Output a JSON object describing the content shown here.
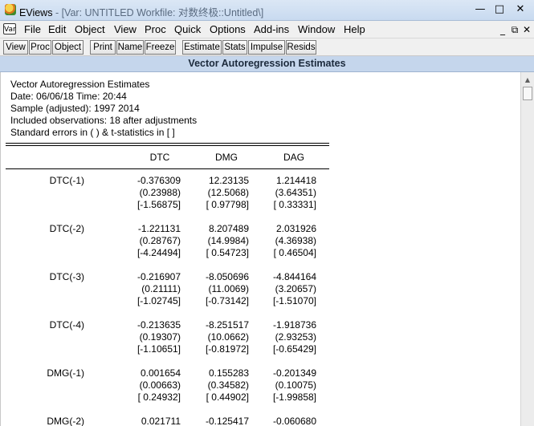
{
  "window": {
    "app_name": "EViews",
    "title_detail": " - [Var: UNTITLED    Workfile: 对数终极::Untitled\\]",
    "minimize": "—",
    "restore": "□",
    "close": "✕",
    "mdi_minimize": "_",
    "mdi_restore": "⧉",
    "mdi_close": "✕"
  },
  "menu": {
    "icon_label": "Var",
    "items": [
      "File",
      "Edit",
      "Object",
      "View",
      "Proc",
      "Quick",
      "Options",
      "Add-ins",
      "Window",
      "Help"
    ]
  },
  "toolbar": {
    "buttons": [
      "View",
      "Proc",
      "Object",
      "Print",
      "Name",
      "Freeze",
      "Estimate",
      "Stats",
      "Impulse",
      "Resids"
    ]
  },
  "header_band": "Vector Autoregression Estimates",
  "output": {
    "title": "Vector Autoregression Estimates",
    "date_line": "Date: 06/06/18   Time: 20:44",
    "sample_line": "Sample (adjusted): 1997 2014",
    "obs_line": "Included observations: 18 after adjustments",
    "se_line": "Standard errors in ( ) & t-statistics in [ ]",
    "columns": [
      "DTC",
      "DMG",
      "DAG"
    ],
    "rows": [
      {
        "label": "DTC(-1)",
        "coef": [
          "-0.376309",
          "12.23135",
          "1.214418"
        ],
        "se": [
          "(0.23988)",
          "(12.5068)",
          "(3.64351)"
        ],
        "t": [
          "[-1.56875]",
          "[ 0.97798]",
          "[ 0.33331]"
        ]
      },
      {
        "label": "DTC(-2)",
        "coef": [
          "-1.221131",
          "8.207489",
          "2.031926"
        ],
        "se": [
          "(0.28767)",
          "(14.9984)",
          "(4.36938)"
        ],
        "t": [
          "[-4.24494]",
          "[ 0.54723]",
          "[ 0.46504]"
        ]
      },
      {
        "label": "DTC(-3)",
        "coef": [
          "-0.216907",
          "-8.050696",
          "-4.844164"
        ],
        "se": [
          "(0.21111)",
          "(11.0069)",
          "(3.20657)"
        ],
        "t": [
          "[-1.02745]",
          "[-0.73142]",
          "[-1.51070]"
        ]
      },
      {
        "label": "DTC(-4)",
        "coef": [
          "-0.213635",
          "-8.251517",
          "-1.918736"
        ],
        "se": [
          "(0.19307)",
          "(10.0662)",
          "(2.93253)"
        ],
        "t": [
          "[-1.10651]",
          "[-0.81972]",
          "[-0.65429]"
        ]
      },
      {
        "label": "DMG(-1)",
        "coef": [
          "0.001654",
          "0.155283",
          "-0.201349"
        ],
        "se": [
          "(0.00663)",
          "(0.34582)",
          "(0.10075)"
        ],
        "t": [
          "[ 0.24932]",
          "[ 0.44902]",
          "[-1.99858]"
        ]
      },
      {
        "label": "DMG(-2)",
        "coef": [
          "0.021711",
          "-0.125417",
          "-0.060680"
        ],
        "se": [
          "",
          "",
          ""
        ],
        "t": [
          "",
          "",
          ""
        ]
      }
    ]
  }
}
